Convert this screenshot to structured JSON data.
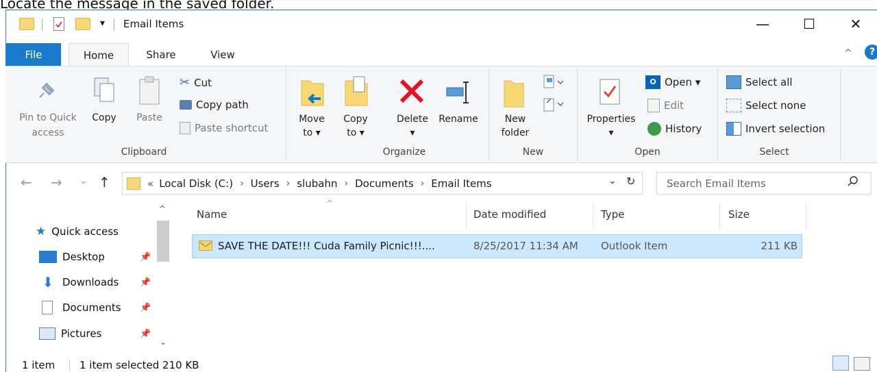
{
  "caption": "Locate the message in the saved folder.",
  "window": {
    "title": "Email Items",
    "minimize": "—",
    "maximize": "☐",
    "close": "✕"
  },
  "tabs": {
    "file": "File",
    "home": "Home",
    "share": "Share",
    "view": "View"
  },
  "ribbon": {
    "clipboard": {
      "label": "Clipboard",
      "pin_line1": "Pin to Quick",
      "pin_line2": "access",
      "copy": "Copy",
      "paste": "Paste",
      "cut": "Cut",
      "copy_path": "Copy path",
      "paste_shortcut": "Paste shortcut"
    },
    "organize": {
      "label": "Organize",
      "move_line1": "Move",
      "move_line2": "to ▾",
      "copy_line1": "Copy",
      "copy_line2": "to ▾",
      "delete": "Delete",
      "delete_arrow": "▾",
      "rename": "Rename"
    },
    "new": {
      "label": "New",
      "folder_line1": "New",
      "folder_line2": "folder"
    },
    "open": {
      "label": "Open",
      "properties": "Properties",
      "properties_arrow": "▾",
      "open": "Open ▾",
      "edit": "Edit",
      "history": "History"
    },
    "select": {
      "label": "Select",
      "select_all": "Select all",
      "select_none": "Select none",
      "invert": "Invert selection"
    }
  },
  "address": {
    "overflow": "«",
    "crumbs": [
      "Local Disk (C:)",
      "Users",
      "slubahn",
      "Documents",
      "Email Items"
    ],
    "separator": "›",
    "dropdown": "⌄",
    "refresh": "↻"
  },
  "search": {
    "placeholder": "Search Email Items"
  },
  "nav_pane": {
    "quick_access": "Quick access",
    "items": [
      "Desktop",
      "Downloads",
      "Documents",
      "Pictures"
    ]
  },
  "columns": {
    "name": "Name",
    "date": "Date modified",
    "type": "Type",
    "size": "Size"
  },
  "files": [
    {
      "name": "SAVE THE DATE!!! Cuda Family Picnic!!!....",
      "date": "8/25/2017 11:34 AM",
      "type": "Outlook Item",
      "size": "211 KB"
    }
  ],
  "status": {
    "count": "1 item",
    "selected": "1 item selected  210 KB"
  },
  "colors": {
    "accent": "#1979ca",
    "selection": "#cce8ff",
    "folder": "#f8d775",
    "delete_red": "#e81123"
  }
}
